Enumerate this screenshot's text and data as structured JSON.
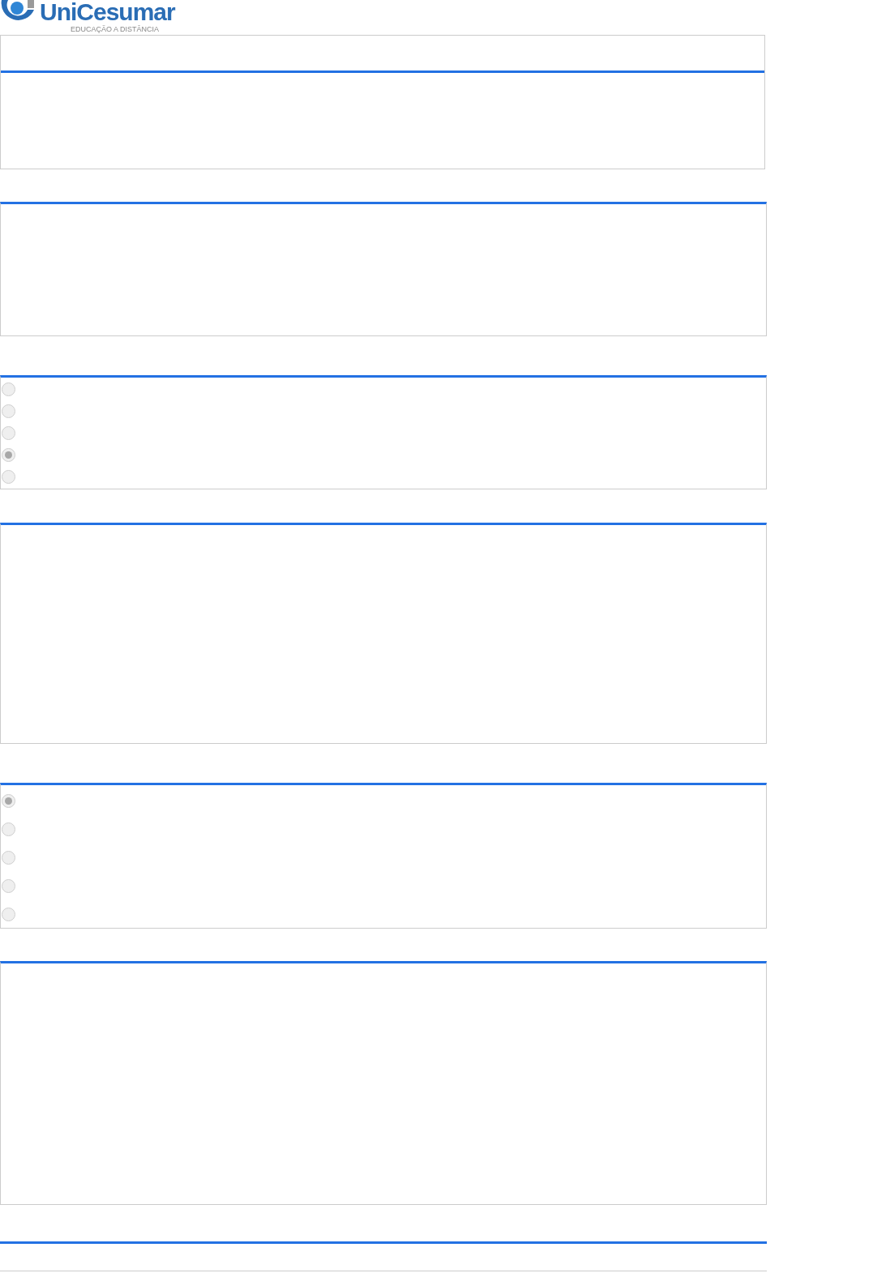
{
  "logo": {
    "name": "UniCesumar",
    "tagline": "EDUCAÇÃO A DISTÂNCIA"
  },
  "panels": [
    {
      "kind": "titled"
    },
    {
      "kind": "blank"
    },
    {
      "kind": "radios",
      "options": [
        {
          "selected": false
        },
        {
          "selected": false
        },
        {
          "selected": false
        },
        {
          "selected": true
        },
        {
          "selected": false
        }
      ]
    },
    {
      "kind": "blank"
    },
    {
      "kind": "radios",
      "options": [
        {
          "selected": true
        },
        {
          "selected": false
        },
        {
          "selected": false
        },
        {
          "selected": false
        },
        {
          "selected": false
        }
      ]
    },
    {
      "kind": "blank"
    },
    {
      "kind": "footer"
    }
  ]
}
